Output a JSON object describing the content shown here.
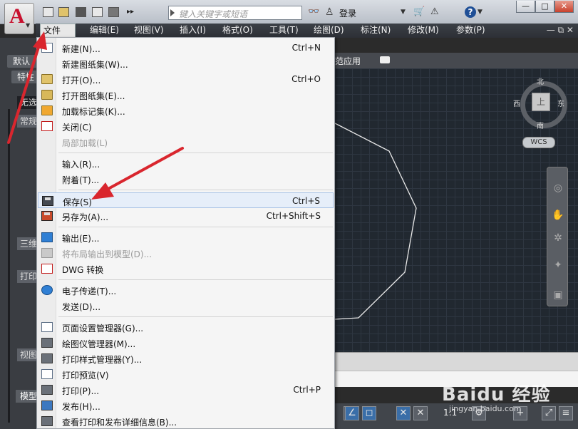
{
  "titlebar": {
    "search_placeholder": "键入关键字或短语",
    "login_label": "登录",
    "help_label": "?",
    "minimize_label": "—",
    "maximize_label": "□",
    "close_label": "✕"
  },
  "menubar": {
    "items": [
      "文件(F)",
      "编辑(E)",
      "视图(V)",
      "插入(I)",
      "格式(O)",
      "工具(T)",
      "绘图(D)",
      "标注(N)",
      "修改(M)",
      "参数(P)"
    ],
    "mdi_controls": "— ⧉ ✕"
  },
  "left_panel": {
    "tab_default": "默认",
    "tab_props": "特性",
    "no_selection": "无选",
    "section_common": "常规",
    "section_3d": "三维",
    "section_print": "打印",
    "section_view": "视图",
    "model_tab": "模型"
  },
  "toolbar2": {
    "label": "范应用"
  },
  "viewcube": {
    "north": "北",
    "south": "南",
    "east": "东",
    "west": "西",
    "top": "上",
    "wcs": "WCS"
  },
  "status": {
    "scale": "1:1"
  },
  "file_menu": {
    "groups": [
      [
        {
          "label": "新建(N)...",
          "shortcut": "Ctrl+N",
          "icon": "new-doc-icon",
          "enabled": true
        },
        {
          "label": "新建图纸集(W)...",
          "shortcut": "",
          "icon": "new-sheetset-icon",
          "enabled": true
        },
        {
          "label": "打开(O)...",
          "shortcut": "Ctrl+O",
          "icon": "open-folder-icon",
          "enabled": true
        },
        {
          "label": "打开图纸集(E)...",
          "shortcut": "",
          "icon": "open-sheetset-icon",
          "enabled": true
        },
        {
          "label": "加载标记集(K)...",
          "shortcut": "",
          "icon": "markup-icon",
          "enabled": true
        },
        {
          "label": "关闭(C)",
          "shortcut": "",
          "icon": "close-doc-icon",
          "enabled": true
        },
        {
          "label": "局部加载(L)",
          "shortcut": "",
          "icon": "",
          "enabled": false
        }
      ],
      [
        {
          "label": "输入(R)...",
          "shortcut": "",
          "icon": "",
          "enabled": true
        },
        {
          "label": "附着(T)...",
          "shortcut": "",
          "icon": "",
          "enabled": true
        }
      ],
      [
        {
          "label": "保存(S)",
          "shortcut": "Ctrl+S",
          "icon": "save-icon",
          "enabled": true,
          "highlighted": true
        },
        {
          "label": "另存为(A)...",
          "shortcut": "Ctrl+Shift+S",
          "icon": "save-as-icon",
          "enabled": true
        }
      ],
      [
        {
          "label": "输出(E)...",
          "shortcut": "",
          "icon": "export-icon",
          "enabled": true
        },
        {
          "label": "将布局输出到模型(D)...",
          "shortcut": "",
          "icon": "layout-export-icon",
          "enabled": false
        },
        {
          "label": "DWG 转换",
          "shortcut": "",
          "icon": "dwg-convert-icon",
          "enabled": true
        }
      ],
      [
        {
          "label": "电子传递(T)...",
          "shortcut": "",
          "icon": "etransmit-icon",
          "enabled": true
        },
        {
          "label": "发送(D)...",
          "shortcut": "",
          "icon": "",
          "enabled": true
        }
      ],
      [
        {
          "label": "页面设置管理器(G)...",
          "shortcut": "",
          "icon": "page-setup-icon",
          "enabled": true
        },
        {
          "label": "绘图仪管理器(M)...",
          "shortcut": "",
          "icon": "plotter-icon",
          "enabled": true
        },
        {
          "label": "打印样式管理器(Y)...",
          "shortcut": "",
          "icon": "plot-style-icon",
          "enabled": true
        },
        {
          "label": "打印预览(V)",
          "shortcut": "",
          "icon": "print-preview-icon",
          "enabled": true
        },
        {
          "label": "打印(P)...",
          "shortcut": "Ctrl+P",
          "icon": "print-icon",
          "enabled": true
        },
        {
          "label": "发布(H)...",
          "shortcut": "",
          "icon": "publish-icon",
          "enabled": true
        },
        {
          "label": "查看打印和发布详细信息(B)...",
          "shortcut": "",
          "icon": "plot-details-icon",
          "enabled": true
        }
      ]
    ]
  },
  "watermark": {
    "brand": "Baidu 经验",
    "url": "jingyan.baidu.com"
  },
  "colors": {
    "accent_red": "#d9262e",
    "menu_highlight": "#e6eef9"
  }
}
